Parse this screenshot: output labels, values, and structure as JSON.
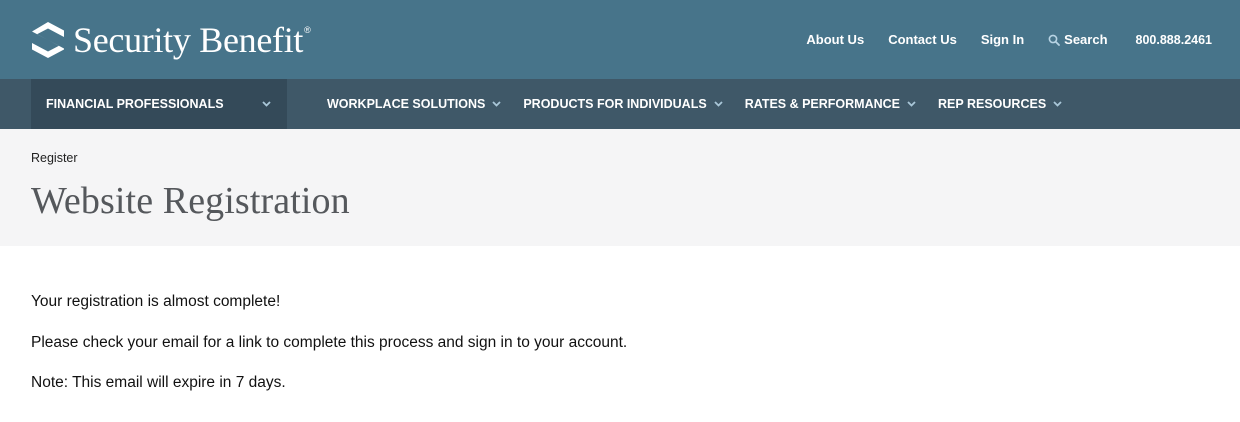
{
  "brand": {
    "name": "Security Benefit",
    "reg_mark": "®",
    "primary_color": "#47748a",
    "nav_color": "#3f5868"
  },
  "utility_nav": {
    "about": "About Us",
    "contact": "Contact Us",
    "signin": "Sign In",
    "search": "Search",
    "phone": "800.888.2461"
  },
  "main_nav": {
    "primary": "FINANCIAL PROFESSIONALS",
    "items": [
      {
        "label": "WORKPLACE SOLUTIONS"
      },
      {
        "label": "PRODUCTS FOR INDIVIDUALS"
      },
      {
        "label": "RATES & PERFORMANCE"
      },
      {
        "label": "REP RESOURCES"
      }
    ]
  },
  "hero": {
    "breadcrumb": "Register",
    "title": "Website Registration"
  },
  "content": {
    "line1": "Your registration is almost complete!",
    "line2": "Please check your email for a link to complete this process and sign in to your account.",
    "line3": "Note: This email will expire in 7 days."
  }
}
